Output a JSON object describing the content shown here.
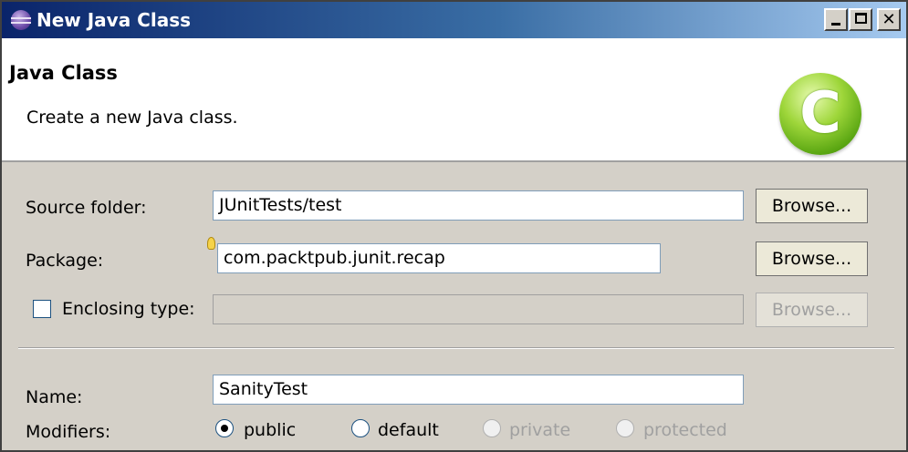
{
  "window": {
    "title": "New Java Class"
  },
  "header": {
    "title": "Java Class",
    "description": "Create a new Java class.",
    "logo_glyph": "C"
  },
  "form": {
    "source_folder": {
      "label": "Source folder:",
      "value": "JUnitTests/test",
      "browse": "Browse..."
    },
    "package": {
      "label": "Package:",
      "value": "com.packtpub.junit.recap",
      "browse": "Browse..."
    },
    "enclosing_type": {
      "label": "Enclosing type:",
      "value": "",
      "browse": "Browse...",
      "checked": false
    },
    "name": {
      "label": "Name:",
      "value": "SanityTest"
    },
    "modifiers": {
      "label": "Modifiers:",
      "options": [
        "public",
        "default",
        "private",
        "protected"
      ],
      "selected": "public"
    }
  },
  "icons": {
    "window": "eclipse-icon",
    "header": "java-class-icon"
  }
}
